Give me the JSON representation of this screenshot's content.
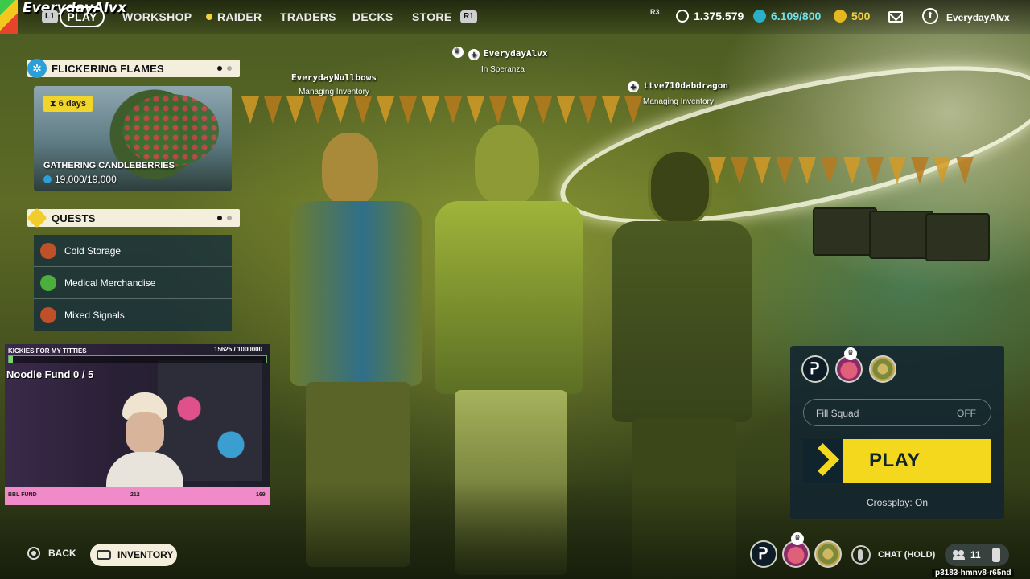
{
  "overlay": {
    "streamer_name": "EverydayAlvx"
  },
  "topbar": {
    "hint_left": "L1",
    "hint_right": "R1",
    "nav": {
      "play": "PLAY",
      "workshop": "WORKSHOP",
      "raider": "RAIDER",
      "traders": "TRADERS",
      "decks": "DECKS",
      "store": "STORE"
    },
    "r3_label": "R3",
    "currencies": {
      "coins": "1.375.579",
      "cred": "6.109/800",
      "tokens": "500"
    },
    "username": "EverydayAlvx",
    "colors": {
      "cred": "#2ab0c8",
      "tokens": "#e6b820",
      "coins": "#ffffff"
    }
  },
  "players": [
    {
      "name": "EverydayNullbows",
      "status": "Managing Inventory"
    },
    {
      "name": "EverydayAlvx",
      "status": "In Speranza",
      "leader": true
    },
    {
      "name": "ttve710dabdragon",
      "status": "Managing Inventory"
    }
  ],
  "event": {
    "header": "FLICKERING FLAMES",
    "days": "6 days",
    "title": "GATHERING CANDLEBERRIES",
    "progress": "19,000/19,000"
  },
  "quests": {
    "header": "QUESTS",
    "items": [
      {
        "label": "Cold Storage",
        "icon_color": "#c0502a"
      },
      {
        "label": "Medical Merchandise",
        "icon_color": "#4cae3c"
      },
      {
        "label": "Mixed Signals",
        "icon_color": "#c0502a"
      }
    ]
  },
  "webcam": {
    "goal_label": "KICKIES FOR MY TITTIES",
    "goal_count": "15625 / 1000000",
    "goal_fraction": 0.016,
    "noodle": "Noodle Fund  0 / 5",
    "bar_left": "BBL FUND",
    "bar_mid": "212",
    "bar_right": "169"
  },
  "bottom_left": {
    "back": "BACK",
    "inventory": "INVENTORY"
  },
  "play_panel": {
    "fill_squad_label": "Fill Squad",
    "fill_squad_value": "OFF",
    "play_label": "PLAY",
    "crossplay": "Crossplay: On",
    "accent": "#f4d81e"
  },
  "bottom_right": {
    "chat": "CHAT (HOLD)",
    "friends_count": "11",
    "session": "p3183-hmnv8-r65nd"
  }
}
